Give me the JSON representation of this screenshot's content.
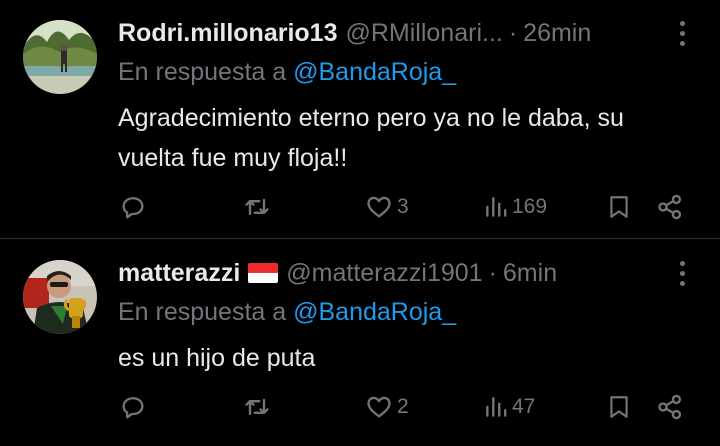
{
  "colors": {
    "background": "#000000",
    "text_primary": "#e7e9ea",
    "text_secondary": "#71767b",
    "link": "#1d9bf0",
    "divider": "#2f3336"
  },
  "tweets": [
    {
      "display_name": "Rodri.millonario13",
      "handle": "@RMillonari...",
      "separator": "·",
      "time": "26min",
      "reply_prefix": "En respuesta a",
      "reply_to": "@BandaRoja_",
      "text": "Agradecimiento eterno pero ya no le daba, su vuelta fue muy floja!!",
      "text_lines": [
        "Agradecimiento eterno pero ya no le daba, su",
        "vuelta fue muy floja!!"
      ],
      "likes": "3",
      "views": "169",
      "icons": [
        "reply-icon",
        "retweet-icon",
        "like-icon",
        "views-icon",
        "bookmark-icon",
        "share-icon",
        "more-icon"
      ]
    },
    {
      "display_name": "matterazzi",
      "flag": "Indonesia/Monaco flag emoji",
      "handle": "@matterazzi1901",
      "separator": "·",
      "time": "6min",
      "reply_prefix": "En respuesta a",
      "reply_to": "@BandaRoja_",
      "text": "es un hijo de puta",
      "likes": "2",
      "views": "47",
      "icons": [
        "reply-icon",
        "retweet-icon",
        "like-icon",
        "views-icon",
        "bookmark-icon",
        "share-icon",
        "more-icon"
      ]
    }
  ]
}
